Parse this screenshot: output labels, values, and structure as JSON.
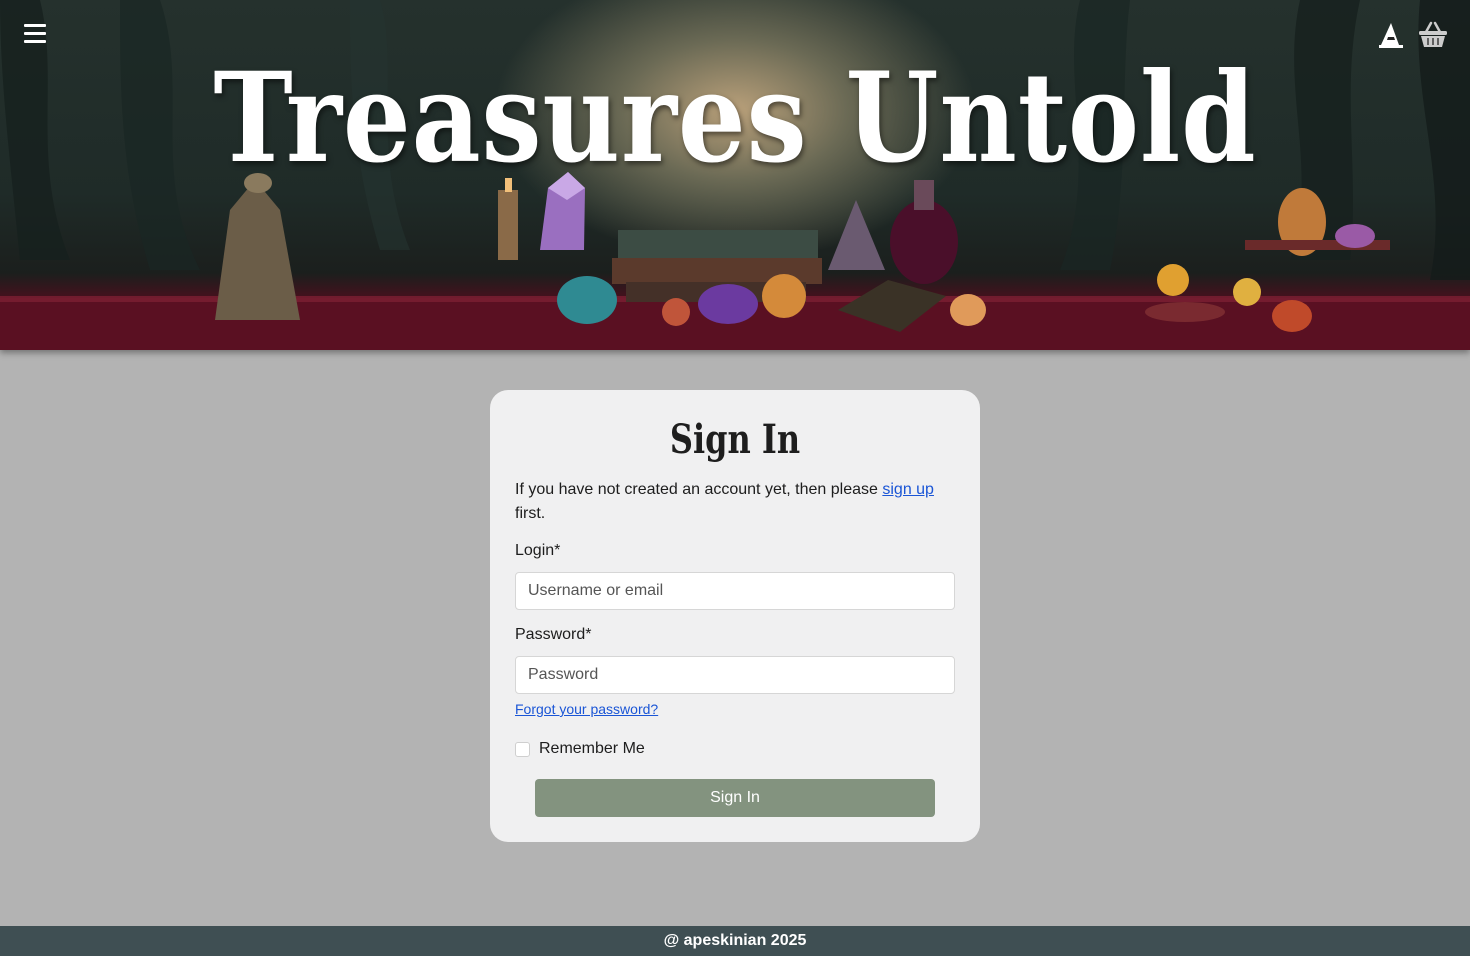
{
  "header": {
    "title": "Treasures Untold",
    "menu_icon": "hamburger-menu-icon",
    "account_icon": "wizard-hat-icon",
    "cart_icon": "basket-icon"
  },
  "signin": {
    "heading": "Sign In",
    "intro_before": "If you have not created an account yet, then please ",
    "signup_link": "sign up",
    "intro_after": " first.",
    "login_label": "Login*",
    "login_placeholder": "Username or email",
    "password_label": "Password*",
    "password_placeholder": "Password",
    "forgot_link": "Forgot your password?",
    "remember_label": "Remember Me",
    "submit_label": "Sign In"
  },
  "footer": {
    "text": "@ apeskinian 2025"
  },
  "colors": {
    "page_bg": "#b3b3b3",
    "card_bg": "#f0f0f1",
    "button": "#83937f",
    "link": "#1a55d6",
    "footer_bg": "#3f4f53"
  }
}
